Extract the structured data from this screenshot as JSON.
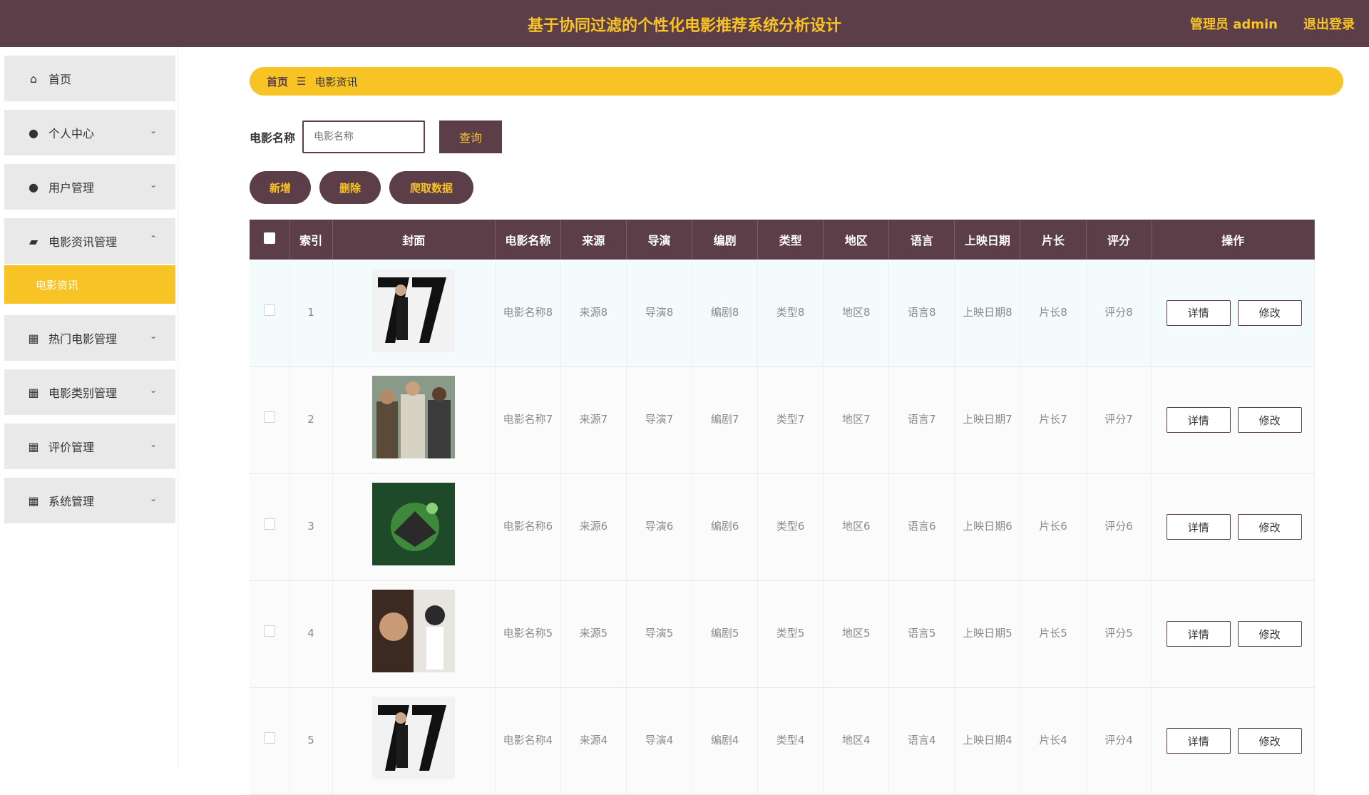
{
  "header": {
    "title": "基于协同过滤的个性化电影推荐系统分析设计",
    "admin": "管理员 admin",
    "logout": "退出登录"
  },
  "sidebar": {
    "items": [
      {
        "label": "首页",
        "icon": "home-icon"
      },
      {
        "label": "个人中心",
        "icon": "user-icon"
      },
      {
        "label": "用户管理",
        "icon": "user-icon"
      },
      {
        "label": "电影资讯管理",
        "icon": "folder-icon"
      },
      {
        "label": "热门电影管理",
        "icon": "grid-icon"
      },
      {
        "label": "电影类别管理",
        "icon": "grid-icon"
      },
      {
        "label": "评价管理",
        "icon": "grid-icon"
      },
      {
        "label": "系统管理",
        "icon": "grid-icon"
      }
    ],
    "active_sub": "电影资讯"
  },
  "breadcrumb": {
    "home": "首页",
    "current": "电影资讯"
  },
  "search": {
    "label": "电影名称",
    "placeholder": "电影名称",
    "button": "查询"
  },
  "actions": {
    "add": "新增",
    "delete": "删除",
    "crawl": "爬取数据"
  },
  "table": {
    "headers": [
      "索引",
      "封面",
      "电影名称",
      "来源",
      "导演",
      "编剧",
      "类型",
      "地区",
      "语言",
      "上映日期",
      "片长",
      "评分",
      "操作"
    ],
    "detail_label": "详情",
    "edit_label": "修改",
    "rows": [
      {
        "index": "1",
        "name": "电影名称8",
        "source": "来源8",
        "director": "导演8",
        "writer": "编剧8",
        "genre": "类型8",
        "region": "地区8",
        "language": "语言8",
        "date": "上映日期8",
        "length": "片长8",
        "rating": "评分8"
      },
      {
        "index": "2",
        "name": "电影名称7",
        "source": "来源7",
        "director": "导演7",
        "writer": "编剧7",
        "genre": "类型7",
        "region": "地区7",
        "language": "语言7",
        "date": "上映日期7",
        "length": "片长7",
        "rating": "评分7"
      },
      {
        "index": "3",
        "name": "电影名称6",
        "source": "来源6",
        "director": "导演6",
        "writer": "编剧6",
        "genre": "类型6",
        "region": "地区6",
        "language": "语言6",
        "date": "上映日期6",
        "length": "片长6",
        "rating": "评分6"
      },
      {
        "index": "4",
        "name": "电影名称5",
        "source": "来源5",
        "director": "导演5",
        "writer": "编剧5",
        "genre": "类型5",
        "region": "地区5",
        "language": "语言5",
        "date": "上映日期5",
        "length": "片长5",
        "rating": "评分5"
      },
      {
        "index": "5",
        "name": "电影名称4",
        "source": "来源4",
        "director": "导演4",
        "writer": "编剧4",
        "genre": "类型4",
        "region": "地区4",
        "language": "语言4",
        "date": "上映日期4",
        "length": "片长4",
        "rating": "评分4"
      }
    ]
  },
  "colors": {
    "primary": "#5b3e47",
    "accent": "#f7c325"
  }
}
